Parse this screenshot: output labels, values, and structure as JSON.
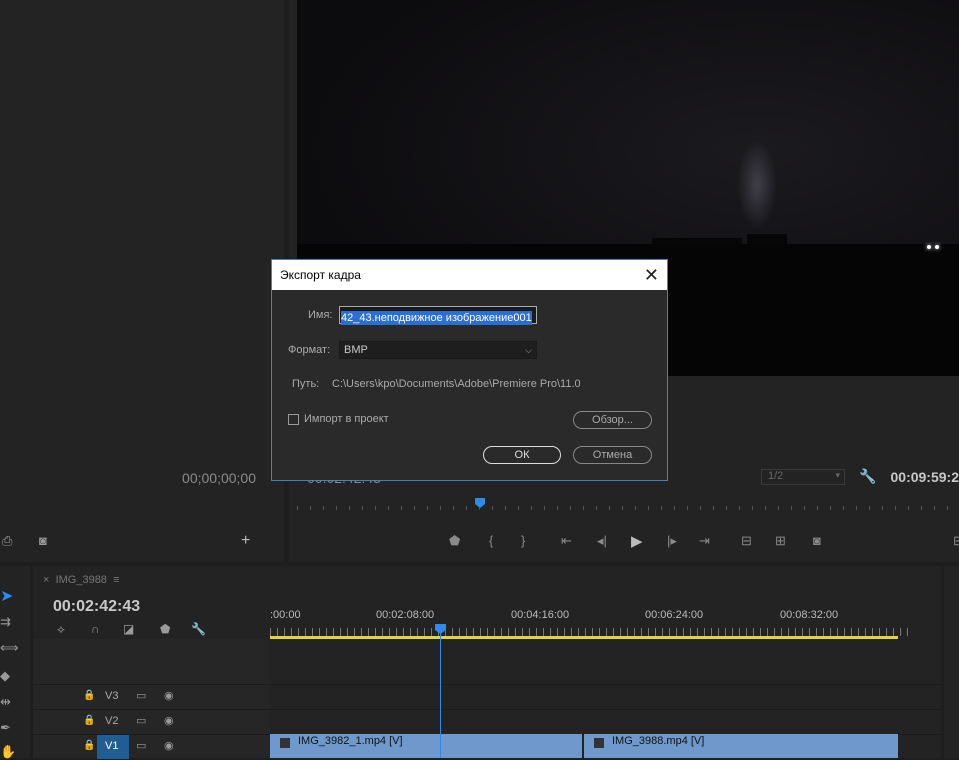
{
  "source_monitor": {
    "timecode": "00;00;00;00"
  },
  "program_monitor": {
    "timecode_left": "00:02:42:43",
    "zoom": "1/2",
    "timecode_right": "00:09:59:2"
  },
  "timeline": {
    "tab_close": "×",
    "tab_name": "IMG_3988",
    "tab_menu": "≡",
    "timecode": "00:02:42:43",
    "ruler_labels": [
      ":00:00",
      "00:02:08:00",
      "00:04:16:00",
      "00:06:24:00",
      "00:08:32:00"
    ],
    "tracks": [
      {
        "name": "V3"
      },
      {
        "name": "V2"
      },
      {
        "name": "V1"
      }
    ],
    "clips": [
      {
        "label": "IMG_3982_1.mp4 [V]"
      },
      {
        "label": "IMG_3988.mp4 [V]"
      }
    ]
  },
  "dialog": {
    "title": "Экспорт кадра",
    "close": "✕",
    "name_label": "Имя:",
    "name_value": "42_43.неподвижное изображение001",
    "format_label": "Формат:",
    "format_value": "BMP",
    "path_label": "Путь:",
    "path_value": "C:\\Users\\kpo\\Documents\\Adobe\\Premiere Pro\\11.0",
    "import_label": "Импорт в проект",
    "browse_label": "Обзор...",
    "ok_label": "ОК",
    "cancel_label": "Отмена"
  }
}
